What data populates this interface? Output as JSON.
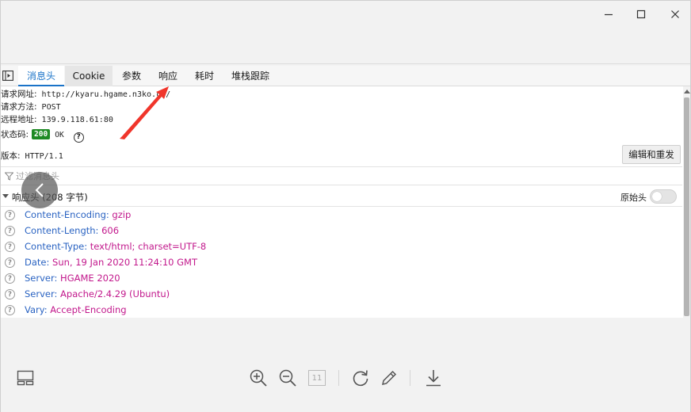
{
  "window": {
    "controls": {
      "minimize_icon": "minimize-icon",
      "maximize_icon": "maximize-icon",
      "close_icon": "close-icon"
    }
  },
  "devtools": {
    "tabs": [
      {
        "label": "消息头",
        "active": true
      },
      {
        "label": "Cookie",
        "active": false
      },
      {
        "label": "参数",
        "active": false
      },
      {
        "label": "响应",
        "active": false
      },
      {
        "label": "耗时",
        "active": false
      },
      {
        "label": "堆栈跟踪",
        "active": false
      }
    ],
    "request": {
      "url_label": "请求网址:",
      "url_value": "http://kyaru.hgame.n3ko.co/",
      "method_label": "请求方法:",
      "method_value": "POST",
      "remote_label": "远程地址:",
      "remote_value": "139.9.118.61:80",
      "status_label": "状态码:",
      "status_code": "200",
      "status_text": "OK",
      "help_glyph": "?",
      "version_label": "版本:",
      "version_value": "HTTP/1.1"
    },
    "resend_button": "编辑和重发",
    "filter": {
      "placeholder": "过滤消息头"
    },
    "response_headers": {
      "title": "响应头 (208 字节)",
      "raw_toggle_label": "原始头",
      "raw_toggle_on": false,
      "rows": [
        {
          "name": "Content-Encoding:",
          "value": "gzip"
        },
        {
          "name": "Content-Length:",
          "value": "606"
        },
        {
          "name": "Content-Type:",
          "value": "text/html; charset=UTF-8"
        },
        {
          "name": "Date:",
          "value": "Sun, 19 Jan 2020 11:24:10 GMT"
        },
        {
          "name": "Server:",
          "value": "HGAME 2020"
        },
        {
          "name": "Server:",
          "value": "Apache/2.4.29 (Ubuntu)"
        },
        {
          "name": "Vary:",
          "value": "Accept-Encoding"
        }
      ]
    }
  },
  "toolbar": {
    "page_number": "11",
    "icons": [
      "layout-icon",
      "zoom-in-icon",
      "zoom-out-icon",
      "page-icon",
      "rotate-icon",
      "edit-icon",
      "download-icon"
    ]
  },
  "colors": {
    "accent": "#1a73c8",
    "status_ok": "#1e8a24",
    "header_name": "#2a63c2",
    "header_value": "#c2188c",
    "annotation_arrow": "#f0352b"
  }
}
